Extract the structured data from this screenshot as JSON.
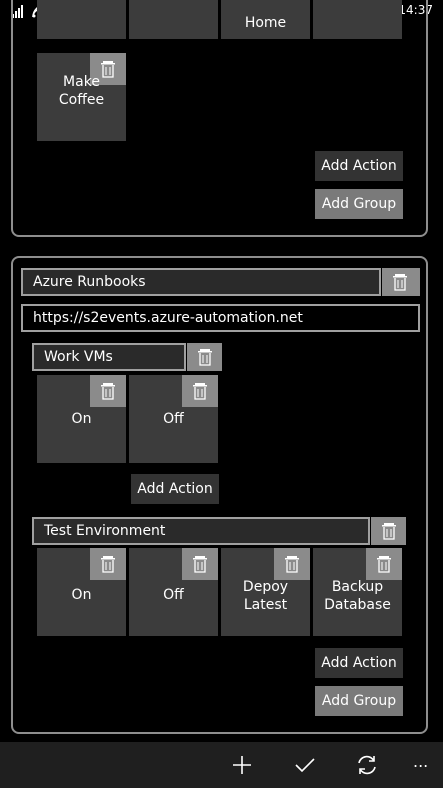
{
  "status": {
    "time": "14:37"
  },
  "group1": {
    "tiles": [
      {
        "label": ""
      },
      {
        "label": ""
      },
      {
        "label": "Home"
      },
      {
        "label": ""
      }
    ],
    "make_coffee_line1": "Make",
    "make_coffee_line2": "Coffee",
    "add_action": "Add Action",
    "add_group": "Add Group"
  },
  "group2": {
    "name": "Azure Runbooks",
    "url": "https://s2events.azure-automation.net",
    "subgroup1": {
      "name": "Work VMs",
      "tiles": [
        {
          "label": "On"
        },
        {
          "label": "Off"
        }
      ],
      "add_action": "Add Action"
    },
    "subgroup2": {
      "name": "Test Environment",
      "tiles": [
        {
          "line1": "On",
          "line2": ""
        },
        {
          "line1": "Off",
          "line2": ""
        },
        {
          "line1": "Depoy",
          "line2": "Latest"
        },
        {
          "line1": "Backup",
          "line2": "Database"
        }
      ],
      "add_action": "Add Action",
      "add_group": "Add Group"
    }
  },
  "appbar": {
    "icons": [
      "add-icon",
      "check-icon",
      "refresh-icon",
      "more-icon"
    ],
    "more": "..."
  }
}
